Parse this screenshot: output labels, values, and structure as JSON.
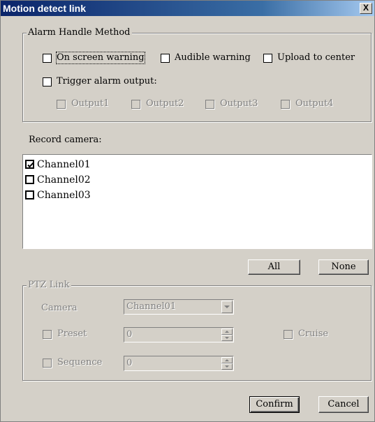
{
  "window": {
    "title": "Motion detect link",
    "close_glyph": "X"
  },
  "alarm_group": {
    "legend": "Alarm Handle Method",
    "on_screen_warning": {
      "label": "On screen warning",
      "checked": false
    },
    "audible_warning": {
      "label": "Audible warning",
      "checked": false
    },
    "upload_to_center": {
      "label": "Upload to center",
      "checked": false
    },
    "trigger_alarm_output": {
      "label": "Trigger alarm output:",
      "checked": false
    },
    "outputs": [
      "Output1",
      "Output2",
      "Output3",
      "Output4"
    ]
  },
  "record_camera": {
    "label": "Record camera:",
    "channels": [
      {
        "label": "Channel01",
        "checked": true
      },
      {
        "label": "Channel02",
        "checked": false
      },
      {
        "label": "Channel03",
        "checked": false
      }
    ],
    "all_label": "All",
    "none_label": "None"
  },
  "ptz_group": {
    "legend": "PTZ Link",
    "camera_label": "Camera",
    "camera_value": "Channel01",
    "preset_label": "Preset",
    "preset_value": "0",
    "cruise_label": "Cruise",
    "sequence_label": "Sequence",
    "sequence_value": "0"
  },
  "footer": {
    "confirm_label": "Confirm",
    "cancel_label": "Cancel"
  },
  "colors": {
    "face": "#d4d0c8",
    "title_start": "#0a246a",
    "title_end": "#a6caf0",
    "disabled_text": "#808080"
  }
}
